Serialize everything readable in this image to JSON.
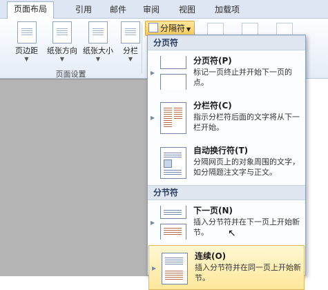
{
  "tabs": [
    {
      "label": "页面布局"
    },
    {
      "label": "引用"
    },
    {
      "label": "邮件"
    },
    {
      "label": "审阅"
    },
    {
      "label": "视图"
    },
    {
      "label": "加载项"
    }
  ],
  "ribbon": {
    "group_label": "页面设置",
    "buttons": [
      {
        "label": "页边距"
      },
      {
        "label": "纸张方向"
      },
      {
        "label": "纸张大小"
      },
      {
        "label": "分栏"
      }
    ],
    "breaks_button": "分隔符"
  },
  "menu": {
    "sections": [
      {
        "title": "分页符",
        "items": [
          {
            "title": "分页符(P)",
            "desc": "标记一页终止并开始下一页的点。"
          },
          {
            "title": "分栏符(C)",
            "desc": "指示分栏符后面的文字将从下一栏开始。"
          },
          {
            "title": "自动换行符(T)",
            "desc": "分隔网页上的对象周围的文字，如分隔题注文字与正文。"
          }
        ]
      },
      {
        "title": "分节符",
        "items": [
          {
            "title": "下一页(N)",
            "desc": "插入分节符并在下一页上开始新节。"
          },
          {
            "title": "连续(O)",
            "desc": "插入分节符并在同一页上开始新节。"
          }
        ]
      }
    ]
  }
}
